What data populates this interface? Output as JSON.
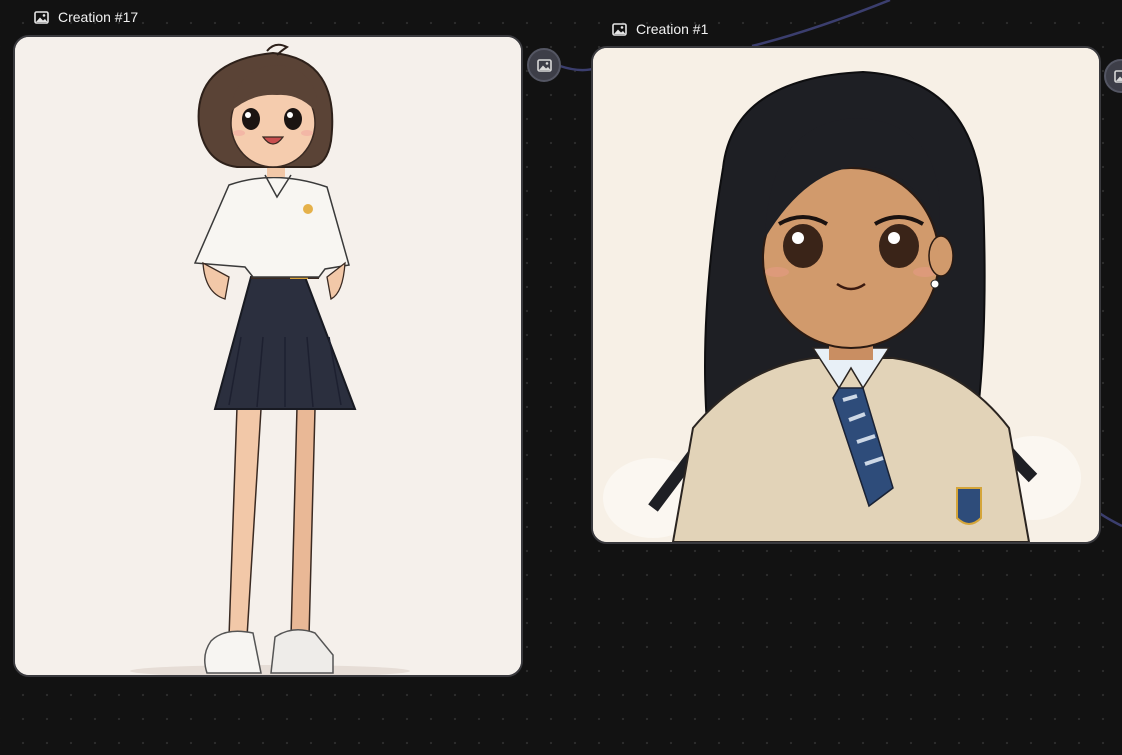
{
  "nodes": [
    {
      "title": "Creation #17",
      "icon": "image-icon",
      "image": "anime girl in white polo shirt and navy pleated skirt, full body"
    },
    {
      "title": "Creation #1",
      "icon": "image-icon",
      "image": "anime girl with long black hair in beige sweater vest and striped tie, portrait"
    }
  ],
  "ports": [
    {
      "icon": "image-icon"
    },
    {
      "icon": "image-icon"
    }
  ],
  "colors": {
    "canvas_background": "#121212",
    "grid_dot": "#2c2c2c",
    "edge": "#3b3e6e",
    "card_border": "#3a3a3e",
    "port_fill": "#3d3e48"
  }
}
